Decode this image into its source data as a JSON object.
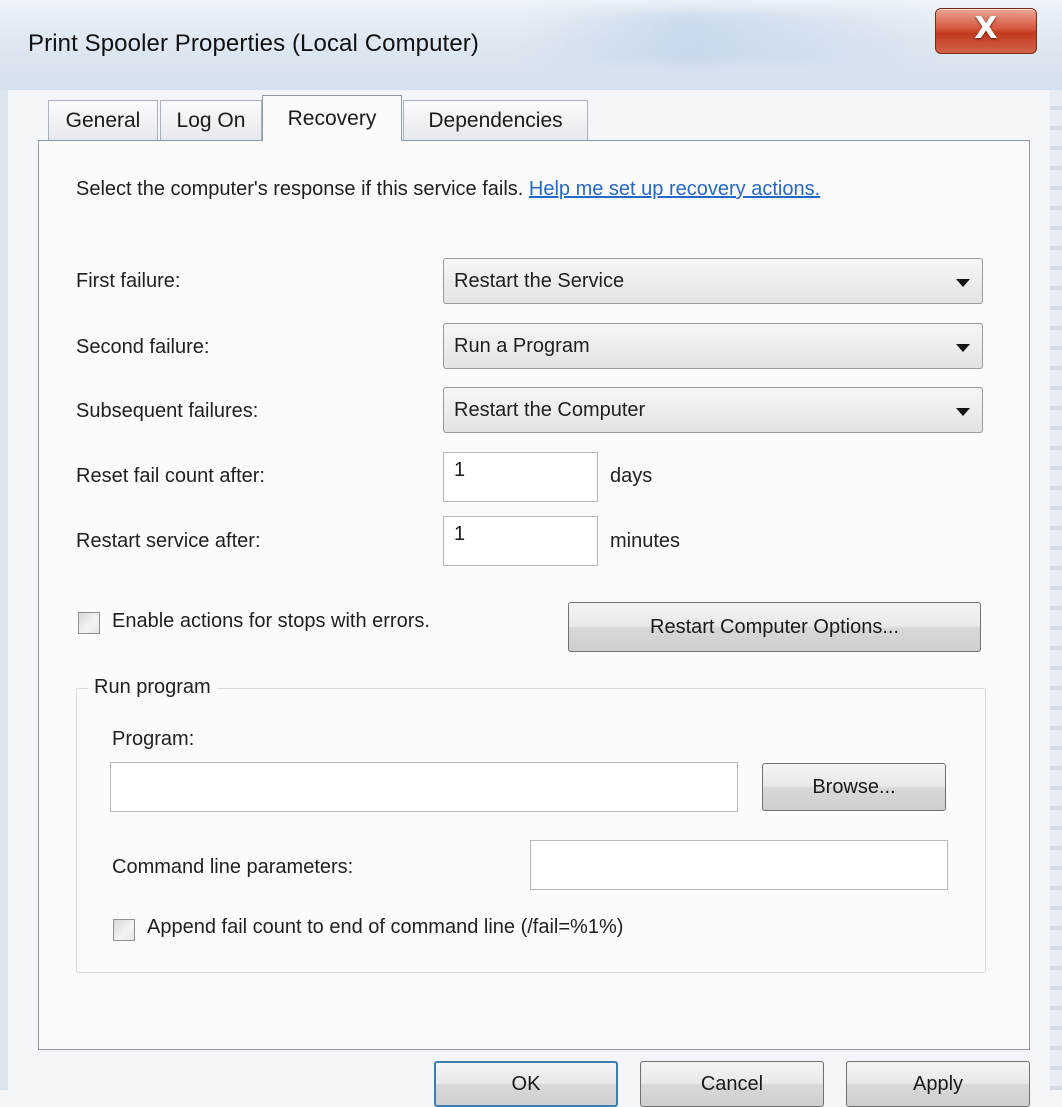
{
  "window": {
    "title": "Print Spooler Properties (Local Computer)",
    "close_glyph": "X"
  },
  "tabs": [
    {
      "label": "General",
      "active": false
    },
    {
      "label": "Log On",
      "active": false
    },
    {
      "label": "Recovery",
      "active": true
    },
    {
      "label": "Dependencies",
      "active": false
    }
  ],
  "recovery": {
    "description": "Select the computer's response if this service fails. ",
    "help_link": "Help me set up recovery actions.",
    "first_failure": {
      "label": "First failure:",
      "value": "Restart the Service"
    },
    "second_failure": {
      "label": "Second failure:",
      "value": "Run a Program"
    },
    "subsequent_failures": {
      "label": "Subsequent failures:",
      "value": "Restart the Computer"
    },
    "reset_fail_count": {
      "label": "Reset fail count after:",
      "value": "1",
      "unit": "days"
    },
    "restart_service": {
      "label": "Restart service after:",
      "value": "1",
      "unit": "minutes"
    },
    "enable_actions": {
      "label": "Enable actions for stops with errors.",
      "checked": false
    },
    "restart_computer_options_button": "Restart Computer Options..."
  },
  "run_program": {
    "group_title": "Run program",
    "program_label": "Program:",
    "program_value": "",
    "browse_button": "Browse...",
    "params_label": "Command line parameters:",
    "params_value": "",
    "append_fail_count": {
      "label": "Append fail count to end of command line (/fail=%1%)",
      "checked": false
    }
  },
  "footer": {
    "ok": "OK",
    "cancel": "Cancel",
    "apply": "Apply"
  }
}
